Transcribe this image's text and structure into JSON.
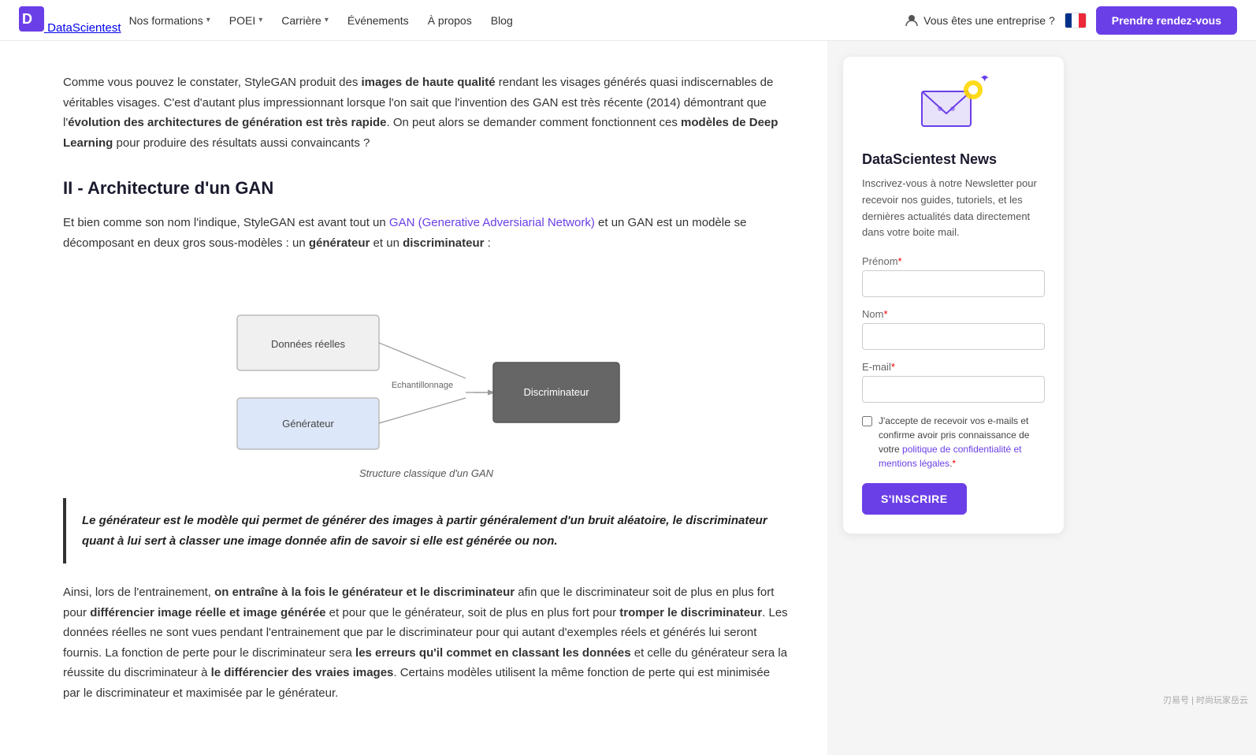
{
  "nav": {
    "logo_text": "DataScientest",
    "items": [
      {
        "label": "Nos formations",
        "has_chevron": true
      },
      {
        "label": "POEI",
        "has_chevron": true
      },
      {
        "label": "Carrière",
        "has_chevron": true
      },
      {
        "label": "Événements",
        "has_chevron": false
      },
      {
        "label": "À propos",
        "has_chevron": false
      },
      {
        "label": "Blog",
        "has_chevron": false
      }
    ],
    "enterprise_label": "Vous êtes une entreprise ?",
    "cta_label": "Prendre rendez-vous"
  },
  "article": {
    "intro": {
      "text_before_bold1": "Comme vous pouvez le constater, StyleGAN produit des ",
      "bold1": "images de haute qualité",
      "text_after_bold1": " rendant les visages générés quasi indiscernables de véritables visages. C'est d'autant plus impressionnant lorsque l'on sait que l'invention des GAN est très récente (2014) démontrant que l'",
      "bold2": "évolution des architectures de génération est très rapide",
      "text_after_bold2": ". On peut alors se demander comment fonctionnent ces ",
      "bold3": "modèles de Deep Learning",
      "text_end": " pour produire des résultats aussi convaincants ?"
    },
    "section_title": "II - Architecture d'un GAN",
    "paragraph1": {
      "text_before_link": "Et bien comme son nom l'indique, StyleGAN est avant tout un ",
      "link_text": "GAN (Generative Adversiarial Network)",
      "text_after_link": " et un GAN est un modèle se décomposant en deux gros sous-modèles : un ",
      "bold1": "générateur",
      "text_mid": " et un ",
      "bold2": "discriminateur",
      "text_end": " :"
    },
    "diagram": {
      "caption": "Structure classique d'un GAN",
      "nodes": {
        "donnees": "Données réelles",
        "generateur": "Générateur",
        "echantillonnage": "Echantillonnage",
        "discriminateur": "Discriminateur"
      }
    },
    "highlight": {
      "text": "Le générateur est le modèle qui permet de générer des images à partir généralement d'un bruit aléatoire, le discriminateur quant à lui sert à classer une image donnée afin de savoir si elle est générée ou non."
    },
    "paragraph2": {
      "text_before_bold1": "Ainsi, lors de l'entrainement, ",
      "bold1": "on entraîne à la fois le générateur et le discriminateur",
      "text_after_bold1": " afin que le discriminateur soit de plus en plus fort pour ",
      "bold2": "différencier image réelle et image générée",
      "text_after_bold2": " et pour que le générateur, soit de plus en plus fort pour ",
      "bold3": "tromper le discriminateur",
      "text_after_bold3": ". Les données réelles ne sont vues pendant l'entrainement que par le discriminateur pour qui autant d'exemples réels et générés lui seront fournis. La fonction de perte pour le discriminateur sera ",
      "bold4": "les erreurs qu'il commet en classant les données",
      "text_after_bold4": " et celle du générateur sera la réussite du discriminateur à ",
      "bold5": "le différencier des vraies images",
      "text_after_bold5": ". Certains modèles utilisent la même fonction de perte qui est minimisée par le discriminateur et maximisée par le générateur."
    }
  },
  "sidebar": {
    "title": "DataScientest News",
    "description": "Inscrivez-vous à notre Newsletter pour recevoir nos guides, tutoriels, et les dernières actualités data directement dans votre boite mail.",
    "form": {
      "prenom_label": "Prénom",
      "prenom_required": "*",
      "nom_label": "Nom",
      "nom_required": "*",
      "email_label": "E-mail",
      "email_required": "*",
      "checkbox_text": "J'accepte de recevoir vos e-mails et confirme avoir pris connaissance de votre politique de confidentialité et mentions légales.",
      "checkbox_required": "*",
      "submit_label": "S'INSCRIRE"
    }
  },
  "watermark": "刃易号 | 时尚玩家岳云"
}
